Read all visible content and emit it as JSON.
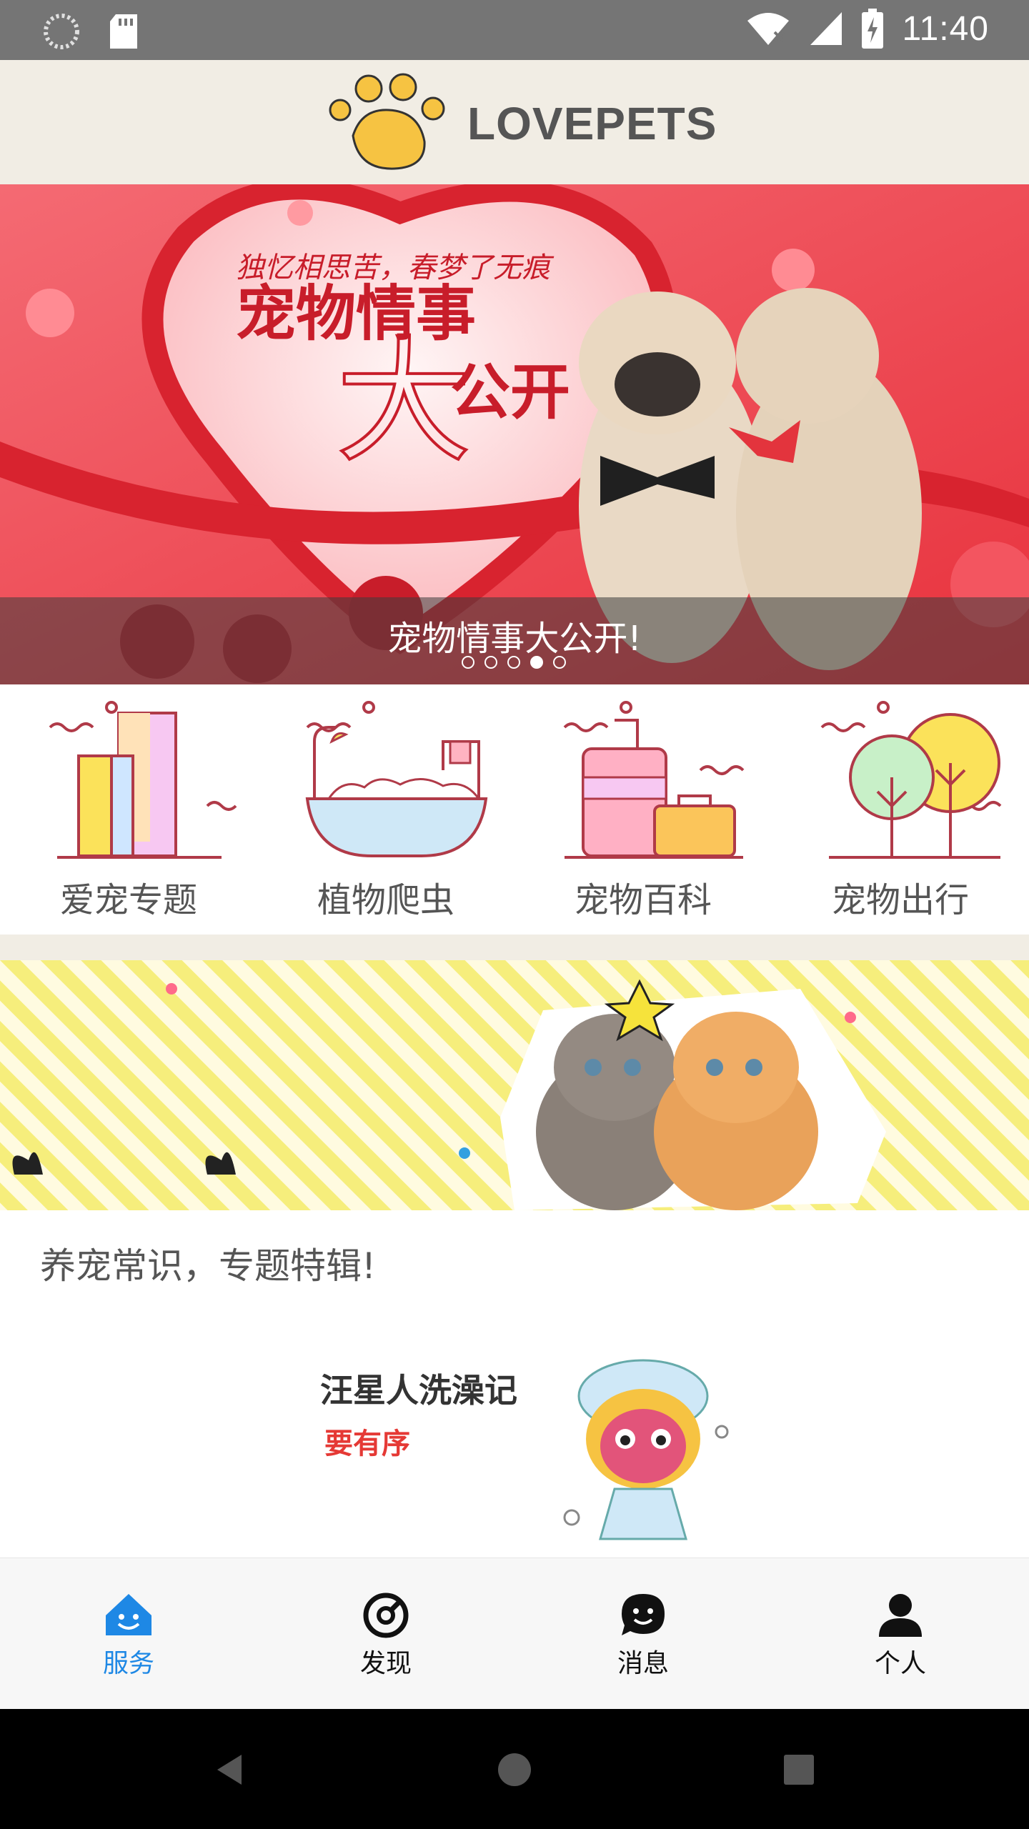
{
  "status_bar": {
    "time": "11:40",
    "icons": [
      "loading-icon",
      "sd-card-icon",
      "wifi-icon",
      "signal-icon",
      "battery-icon"
    ]
  },
  "header": {
    "brand": "LOVEPETS",
    "logo_icon": "paw-icon"
  },
  "banner": {
    "headline_small": "独忆相思苦，春梦了无痕",
    "headline_main": "宠物情事",
    "headline_big": "大",
    "headline_tail": "公开",
    "caption": "宠物情事大公开!",
    "slide_count": 5,
    "active_slide": 3
  },
  "categories": [
    {
      "label": "爱宠专题",
      "icon": "buildings-icon"
    },
    {
      "label": "植物爬虫",
      "icon": "bathtub-icon"
    },
    {
      "label": "宠物百科",
      "icon": "luggage-icon"
    },
    {
      "label": "宠物出行",
      "icon": "trees-icon"
    }
  ],
  "section": {
    "title": "养宠常识，专题特辑!"
  },
  "article": {
    "title": "汪星人洗澡记",
    "subtitle": "要有序"
  },
  "bottom_nav": [
    {
      "label": "服务",
      "icon": "home-smile-icon",
      "active": true
    },
    {
      "label": "发现",
      "icon": "compass-icon",
      "active": false
    },
    {
      "label": "消息",
      "icon": "chat-icon",
      "active": false
    },
    {
      "label": "个人",
      "icon": "person-icon",
      "active": false
    }
  ],
  "colors": {
    "accent": "#1e88e5",
    "header_bg": "#f1ede4",
    "banner_red": "#ef4b55",
    "promo_yellow": "#f6ee7c"
  }
}
